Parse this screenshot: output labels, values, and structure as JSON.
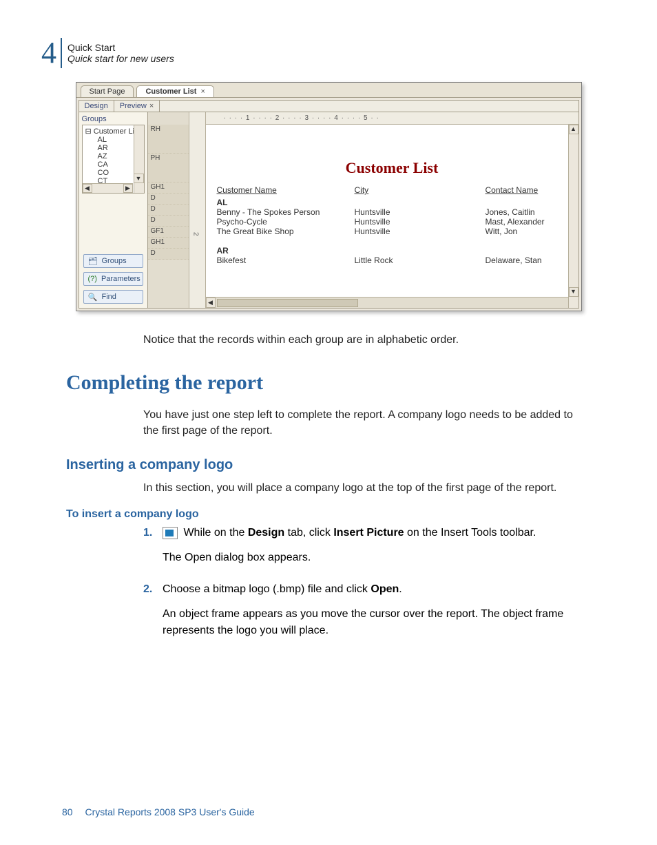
{
  "header": {
    "chapter_number": "4",
    "line1": "Quick Start",
    "line2": "Quick start for new users"
  },
  "screenshot": {
    "tabs": {
      "start": "Start Page",
      "active": "Customer List",
      "close_glyph": "×"
    },
    "subtabs": {
      "design": "Design",
      "preview": "Preview",
      "preview_close": "×"
    },
    "sidebar": {
      "groups_label": "Groups",
      "tree_root": "Customer Lis",
      "tree_items": [
        "AL",
        "AR",
        "AZ",
        "CA",
        "CO",
        "CT"
      ],
      "btn_groups": "Groups",
      "btn_parameters": "Parameters",
      "btn_find": "Find"
    },
    "sections": [
      "RH",
      "PH",
      "GH1",
      "D",
      "D",
      "D",
      "GF1",
      "GH1",
      "D"
    ],
    "ruler_vert": "2",
    "ruler_top": "·  ·  ·  · 1 ·  ·  ·  · 2 ·  ·  ·  · 3 ·  ·  ·  · 4 ·  ·  ·  · 5 ·  ·",
    "title": "Customer List",
    "columns": {
      "c1": "Customer Name",
      "c2": "City",
      "c3": "Contact Name"
    },
    "group_al": "AL",
    "rows_al": [
      {
        "name": "Benny - The Spokes Person",
        "city": "Huntsville",
        "contact": "Jones, Caitlin"
      },
      {
        "name": "Psycho-Cycle",
        "city": "Huntsville",
        "contact": "Mast, Alexander"
      },
      {
        "name": "The Great Bike Shop",
        "city": "Huntsville",
        "contact": "Witt, Jon"
      }
    ],
    "group_ar": "AR",
    "rows_ar": [
      {
        "name": "Bikefest",
        "city": "Little Rock",
        "contact": "Delaware, Stan"
      }
    ]
  },
  "text": {
    "notice": "Notice that the records within each group are in alphabetic order.",
    "h2": "Completing the report",
    "p1": "You have just one step left to complete the report. A company logo needs to be added to the first page of the report.",
    "h3": "Inserting a company logo",
    "p2": "In this section, you will place a company logo at the top of the first page of the report.",
    "h4": "To insert a company logo",
    "steps": {
      "s1_num": "1.",
      "s1a_pre": " While on the ",
      "s1a_b1": "Design",
      "s1a_mid": " tab, click ",
      "s1a_b2": "Insert Picture",
      "s1a_post": " on the Insert Tools toolbar.",
      "s1b": "The Open dialog box appears.",
      "s2_num": "2.",
      "s2a_pre": "Choose a bitmap logo (.bmp) file and click ",
      "s2a_b1": "Open",
      "s2a_post": ".",
      "s2b": "An object frame appears as you move the cursor over the report. The object frame represents the logo you will place."
    }
  },
  "footer": {
    "page": "80",
    "title": "Crystal Reports 2008 SP3 User's Guide"
  }
}
